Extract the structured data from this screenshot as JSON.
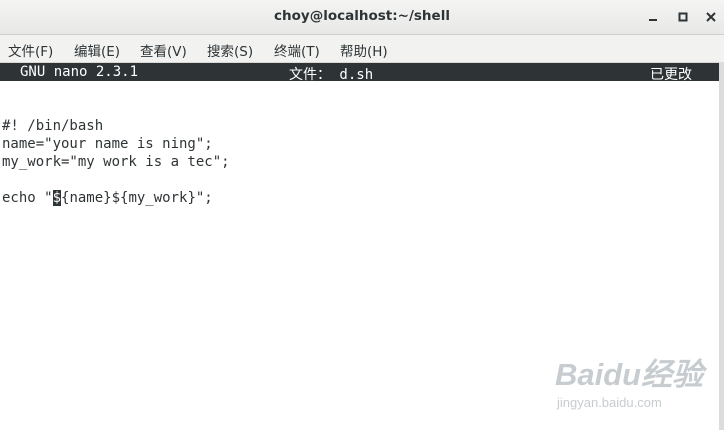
{
  "window": {
    "title": "choy@localhost:~/shell"
  },
  "menu": {
    "items": [
      "文件(F)",
      "编辑(E)",
      "查看(V)",
      "搜索(S)",
      "终端(T)",
      "帮助(H)"
    ]
  },
  "nano": {
    "version": "GNU nano 2.3.1",
    "file_label": "文件： d.sh",
    "status": "已更改"
  },
  "editor": {
    "lines": [
      "",
      "#! /bin/bash",
      "name=\"your name is ning\";",
      "my_work=\"my work is a tec\";",
      "",
      "echo \"${name}${my_work}\";"
    ],
    "cursor": {
      "line": 6,
      "column": 7,
      "char": "$"
    }
  },
  "watermark": {
    "logo": "Baidu经验",
    "url": "jingyan.baidu.com"
  },
  "colors": {
    "nano_bar_bg": "#2e3436",
    "text": "#2e3436",
    "background": "#ffffff"
  },
  "icons": [
    "minimize-icon",
    "maximize-icon",
    "close-icon"
  ]
}
